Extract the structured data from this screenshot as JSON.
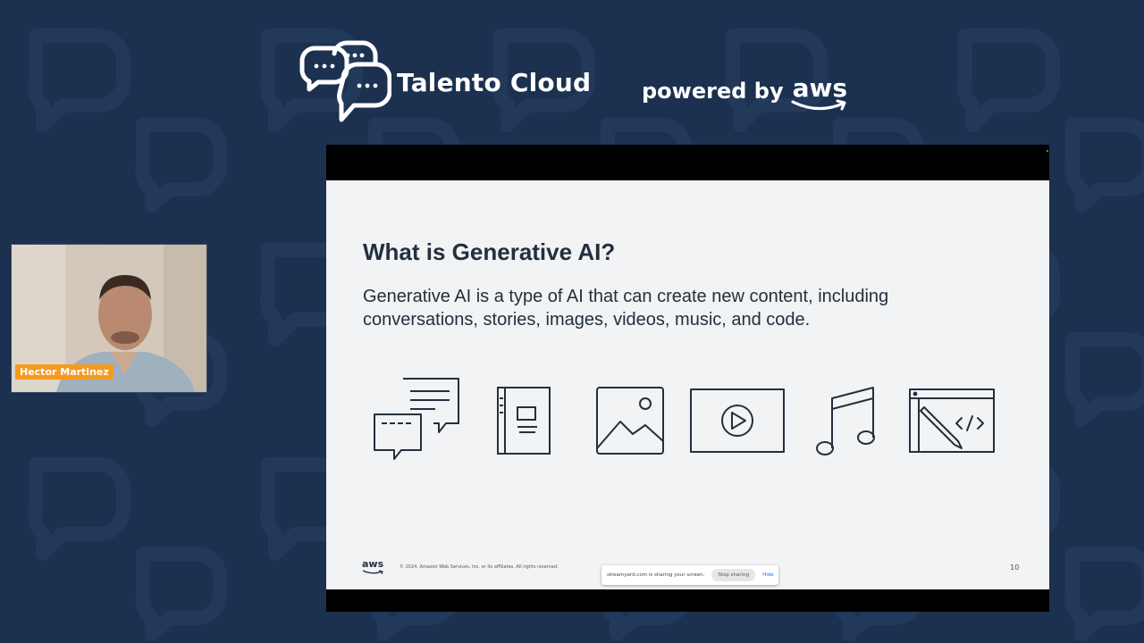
{
  "brand": {
    "name": "Talento Cloud",
    "powered_by": "powered by",
    "aws": "aws"
  },
  "presenter": {
    "name": "Hector Martinez"
  },
  "slide": {
    "title": "What is Generative AI?",
    "body": "Generative AI is a type of AI that can create new content, including conversations, stories, images, videos, music, and code.",
    "icons": [
      "conversation-icon",
      "book-icon",
      "image-icon",
      "video-icon",
      "music-icon",
      "code-icon"
    ],
    "footer_logo": "aws",
    "copyright": "© 2024, Amazon Web Services, Inc. or its affiliates. All rights reserved.",
    "page_number": "10"
  },
  "share_bar": {
    "message": "streamyard.com is sharing your screen.",
    "stop_label": "Stop sharing",
    "hide_label": "Hide"
  },
  "colors": {
    "background": "#1c3150",
    "accent": "#f59a1e",
    "slide_text": "#232f3e"
  }
}
